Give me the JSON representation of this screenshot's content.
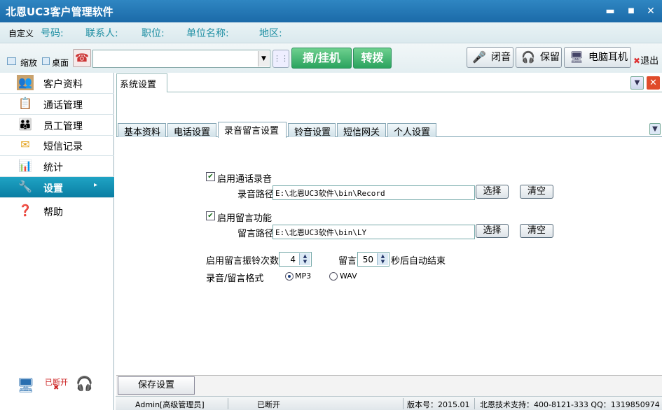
{
  "window": {
    "title": "北恩UC3客户管理软件",
    "minimize": "▬",
    "maximize": "■",
    "close": "✕"
  },
  "infobar": {
    "custom": "自定义",
    "fields": [
      "号码:",
      "联系人:",
      "职位:",
      "单位名称:",
      "地区:"
    ]
  },
  "toolbar": {
    "shrink": "缩放",
    "desktop": "桌面",
    "dial_value": "",
    "hook_label": "摘/挂机",
    "transfer_label": "转拨",
    "mute_label": "闭音",
    "hold_label": "保留",
    "headset_label": "电脑耳机",
    "exit_label": "退出"
  },
  "sidebar": {
    "items": [
      {
        "label": "客户资料",
        "icon": "contacts-icon"
      },
      {
        "label": "通话管理",
        "icon": "call-manage-icon"
      },
      {
        "label": "员工管理",
        "icon": "staff-icon"
      },
      {
        "label": "短信记录",
        "icon": "envelope-icon"
      },
      {
        "label": "统计",
        "icon": "bar-chart-icon"
      },
      {
        "label": "设置",
        "icon": "settings-icon",
        "active": true
      },
      {
        "label": "帮助",
        "icon": "help-icon"
      }
    ],
    "connection_status": "已断开"
  },
  "main": {
    "outer_tab": "系统设置",
    "subtabs": [
      "基本资料",
      "电话设置",
      "录音留言设置",
      "铃音设置",
      "短信网关",
      "个人设置"
    ],
    "active_subtab": "录音留言设置",
    "recording": {
      "enable_label": "启用通话录音",
      "enabled": true,
      "path_label": "录音路径",
      "path": "E:\\北恩UC3软件\\bin\\Record"
    },
    "voicemail": {
      "enable_label": "启用留言功能",
      "enabled": true,
      "path_label": "留言路径",
      "path": "E:\\北恩UC3软件\\bin\\LY"
    },
    "choose_label": "选择",
    "clear_label": "清空",
    "ring_count_label": "启用留言振铃次数",
    "ring_count": "4",
    "message_label": "留言",
    "message_seconds": "50",
    "auto_end_label": "秒后自动结束",
    "format_label": "录音/留言格式",
    "formats": [
      "MP3",
      "WAV"
    ],
    "selected_format": "MP3",
    "save_label": "保存设置"
  },
  "statusbar": {
    "user": "Admin[高级管理员]",
    "connection": "已断开",
    "version": "版本号：2015.01",
    "support": "北恩技术支持：400-8121-333 QQ：1319850974"
  }
}
